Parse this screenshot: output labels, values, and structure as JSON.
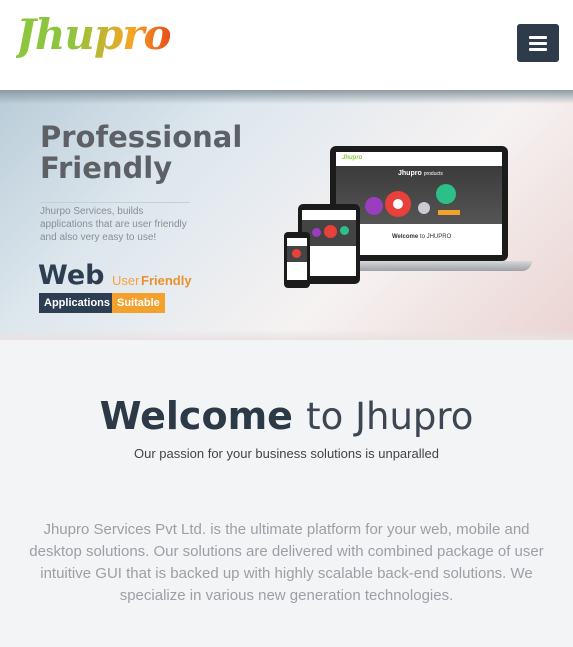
{
  "header": {
    "logo": "Jhupro",
    "menu_icon": "hamburger-menu-icon"
  },
  "hero": {
    "title_line1": "Professional",
    "title_line2": "Friendly",
    "description": "Jhurpo Services, builds applications that are user friendly and also very easy to use!",
    "web": "Web",
    "user": "User",
    "friendly": "Friendly",
    "tag_applications": "Applications",
    "tag_suitable": "Suitable",
    "mockup": {
      "laptop_brand": "Jhupro",
      "laptop_headline": "Jhupro",
      "laptop_headline_suffix": "products",
      "laptop_welcome": "Welcome",
      "laptop_welcome_suffix": "to JHUPRO"
    }
  },
  "welcome": {
    "title_bold": "Welcome",
    "title_rest": "to Jhupro",
    "subtitle": "Our passion for your business solutions is unparalled"
  },
  "intro": {
    "text": "Jhupro Services Pvt Ltd. is the ultimate platform for your web, mobile and desktop solutions. Our solutions are delivered with combined package of user intuitive GUI that is backed up with highly scalable back-end solutions. We specialize in various new generation technologies."
  },
  "colors": {
    "navy": "#2e3e52",
    "orange": "#f2a12d",
    "logo_green": "#8cc63f",
    "logo_orange": "#f5a623"
  }
}
